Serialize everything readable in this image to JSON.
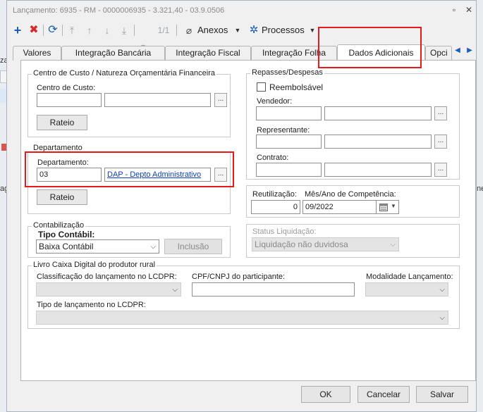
{
  "background": {
    "left_fragment_1": "za",
    "left_fragment_2": "ag",
    "right_fragment": "ne"
  },
  "window": {
    "title": "Lançamento: 6935 - RM - 0000006935 - 3.321,40 - 03.9.0506",
    "restore_glyph": "▫",
    "close_glyph": "✕"
  },
  "toolbar": {
    "add_icon": "plus-icon",
    "delete_icon": "x-icon",
    "refresh_icon": "refresh-icon",
    "record_counter": "1/1",
    "anexos_label": "Anexos",
    "processos_label": "Processos"
  },
  "tabs": [
    {
      "label": "Valores"
    },
    {
      "label": "Integração Bancária"
    },
    {
      "label": "Integração Fiscal"
    },
    {
      "label": "Integração Folha"
    },
    {
      "label": "Dados Adicionais"
    },
    {
      "label": "Opci"
    }
  ],
  "centro_custo": {
    "group_label": "Centro de Custo / Natureza Orçamentária Financeira",
    "field_label": "Centro de Custo:",
    "code_value": "",
    "name_value": "",
    "lookup_label": "...",
    "rateio_label": "Rateio"
  },
  "departamento": {
    "group_label": "Departamento",
    "field_label": "Departamento:",
    "code_value": "03",
    "name_value": "DAP - Depto Administrativo",
    "lookup_label": "...",
    "rateio_label": "Rateio"
  },
  "contabilizacao": {
    "group_label": "Contabilização",
    "tipo_label": "Tipo Contábil:",
    "tipo_value": "Baixa Contábil",
    "inclusao_label": "Inclusão"
  },
  "repasses": {
    "group_label": "Repasses/Despesas",
    "reembolsavel_label": "Reembolsável",
    "reembolsavel_checked": false,
    "vendedor_label": "Vendedor:",
    "representante_label": "Representante:",
    "contrato_label": "Contrato:",
    "lookup_label": "..."
  },
  "reutilizacao": {
    "label": "Reutilização:",
    "value": "0"
  },
  "competencia": {
    "label": "Mês/Ano de Competência:",
    "value": "09/2022"
  },
  "status_liquidacao": {
    "label": "Status Liquidação:",
    "value": "Liquidação não duvidosa"
  },
  "livro_caixa": {
    "group_label": "Livro Caixa Digital do produtor rural",
    "classificacao_label": "Classificação do lançamento no LCDPR:",
    "cpf_label": "CPF/CNPJ do participante:",
    "modalidade_label": "Modalidade Lançamento:",
    "tipo_label": "Tipo de lançamento no LCDPR:"
  },
  "footer": {
    "ok_label": "OK",
    "cancel_label": "Cancelar",
    "save_label": "Salvar"
  },
  "colors": {
    "accent_blue": "#1a5fb4",
    "highlight_red": "#e8191c",
    "link_blue": "#0b3fbf"
  }
}
